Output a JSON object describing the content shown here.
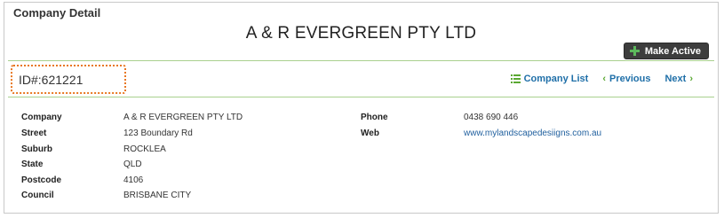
{
  "panel": {
    "title": "Company Detail",
    "company_name": "A & R EVERGREEN PTY LTD",
    "make_active_label": "Make Active"
  },
  "id_box": {
    "text": "ID#:621221"
  },
  "nav": {
    "company_list_label": "Company List",
    "previous_label": "Previous",
    "next_label": "Next"
  },
  "details_left": [
    {
      "label": "Company",
      "value": "A & R EVERGREEN PTY LTD"
    },
    {
      "label": "Street",
      "value": "123 Boundary Rd"
    },
    {
      "label": "Suburb",
      "value": "ROCKLEA"
    },
    {
      "label": "State",
      "value": "QLD"
    },
    {
      "label": "Postcode",
      "value": "4106"
    },
    {
      "label": "Council",
      "value": "BRISBANE CITY"
    }
  ],
  "details_right": [
    {
      "label": "Phone",
      "value": "0438 690 446"
    },
    {
      "label": "Web",
      "value": "www.mylandscapedesiigns.com.au"
    }
  ],
  "colors": {
    "accent_green": "#5aa832",
    "link_blue": "#1f6fa8",
    "id_highlight": "#e87722",
    "button_bg": "#3d3d3d"
  },
  "icons": [
    "plus-icon",
    "list-icon",
    "chevron-left-icon",
    "chevron-right-icon"
  ]
}
